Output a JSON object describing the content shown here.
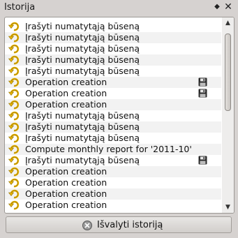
{
  "window": {
    "title": "Istorija",
    "float_glyph": "◆",
    "close_glyph": "✕"
  },
  "history": {
    "items": [
      {
        "label": "Įrašyti numatytąją būseną",
        "icon": "undo-arrow-icon",
        "saved": false
      },
      {
        "label": "Įrašyti numatytąją būseną",
        "icon": "undo-arrow-icon",
        "saved": false
      },
      {
        "label": "Įrašyti numatytąją būseną",
        "icon": "undo-arrow-icon",
        "saved": false
      },
      {
        "label": "Įrašyti numatytąją būseną",
        "icon": "undo-arrow-icon",
        "saved": false
      },
      {
        "label": "Įrašyti numatytąją būseną",
        "icon": "undo-arrow-icon",
        "saved": false
      },
      {
        "label": "Operation creation",
        "icon": "undo-arrow-icon",
        "saved": true
      },
      {
        "label": "Operation creation",
        "icon": "undo-arrow-icon",
        "saved": true
      },
      {
        "label": "Operation creation",
        "icon": "undo-arrow-icon",
        "saved": false
      },
      {
        "label": "Įrašyti numatytąją būseną",
        "icon": "undo-arrow-icon",
        "saved": false
      },
      {
        "label": "Įrašyti numatytąją būseną",
        "icon": "undo-arrow-icon",
        "saved": false
      },
      {
        "label": "Įrašyti numatytąją būseną",
        "icon": "undo-arrow-icon",
        "saved": false
      },
      {
        "label": "Compute monthly report for '2011-10'",
        "icon": "undo-arrow-icon",
        "saved": false
      },
      {
        "label": "Įrašyti numatytąją būseną",
        "icon": "undo-arrow-icon",
        "saved": true
      },
      {
        "label": "Operation creation",
        "icon": "undo-arrow-icon",
        "saved": false
      },
      {
        "label": "Operation creation",
        "icon": "undo-arrow-icon",
        "saved": false
      },
      {
        "label": "Operation creation",
        "icon": "undo-arrow-icon",
        "saved": false
      },
      {
        "label": "Operation creation",
        "icon": "undo-arrow-icon",
        "saved": false
      }
    ]
  },
  "scroll": {
    "position_fraction": 0.05,
    "visible_fraction": 0.45,
    "up_glyph": "▲",
    "down_glyph": "▼"
  },
  "clear_button": {
    "label": "Išvalyti istoriją",
    "icon": "clear-history-icon"
  },
  "colors": {
    "panel_bg": "#d6d2d0",
    "list_bg": "#ffffff",
    "alt_row_bg": "#f2f2f2",
    "icon_yellow": "#e8b400"
  }
}
